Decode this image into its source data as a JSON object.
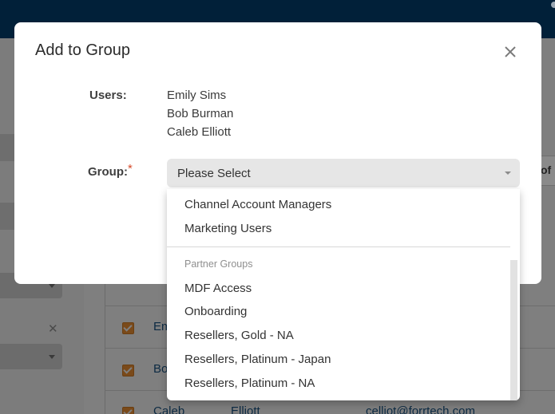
{
  "background": {
    "rows": [
      {
        "first": "Em",
        "last": "",
        "email": ""
      },
      {
        "first": "Bo",
        "last": "",
        "email": ""
      },
      {
        "first": "Caleb",
        "last": "Elliott",
        "email": "celliot@forrtech.com"
      }
    ],
    "pagination_fragment": "of"
  },
  "modal": {
    "title": "Add to Group",
    "users_label": "Users:",
    "users": [
      "Emily Sims",
      "Bob Burman",
      "Caleb Elliott"
    ],
    "group_label": "Group:",
    "required_marker": "*",
    "select": {
      "value": "Please Select",
      "options_top": [
        "Channel Account Managers",
        "Marketing Users"
      ],
      "group_header": "Partner Groups",
      "options_group": [
        "MDF Access",
        "Onboarding",
        "Resellers, Gold - NA",
        "Resellers, Platinum - Japan",
        "Resellers, Platinum - NA"
      ]
    }
  },
  "colors": {
    "topbar": "#012039",
    "required": "#d64b2b",
    "checkbox": "#e07b23",
    "overlay": "#7f7f7f"
  },
  "icons": {
    "close": "close-icon",
    "caret": "chevron-down-icon",
    "checkbox": "checkbox-checked-icon"
  }
}
